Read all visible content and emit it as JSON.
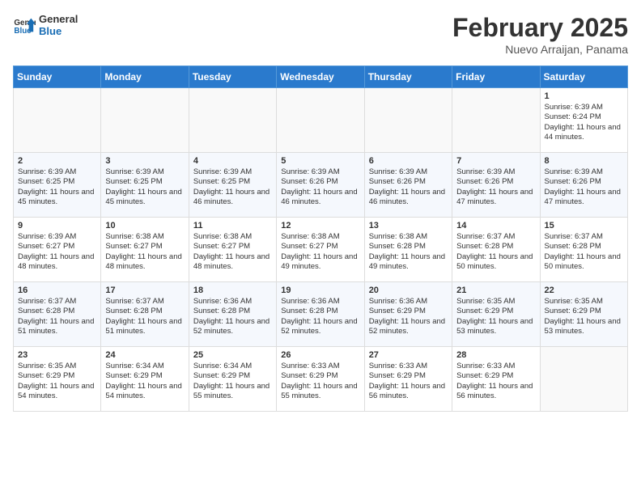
{
  "logo": {
    "line1": "General",
    "line2": "Blue"
  },
  "title": "February 2025",
  "subtitle": "Nuevo Arraijan, Panama",
  "days_header": [
    "Sunday",
    "Monday",
    "Tuesday",
    "Wednesday",
    "Thursday",
    "Friday",
    "Saturday"
  ],
  "weeks": [
    [
      {
        "day": "",
        "info": ""
      },
      {
        "day": "",
        "info": ""
      },
      {
        "day": "",
        "info": ""
      },
      {
        "day": "",
        "info": ""
      },
      {
        "day": "",
        "info": ""
      },
      {
        "day": "",
        "info": ""
      },
      {
        "day": "1",
        "info": "Sunrise: 6:39 AM\nSunset: 6:24 PM\nDaylight: 11 hours and 44 minutes."
      }
    ],
    [
      {
        "day": "2",
        "info": "Sunrise: 6:39 AM\nSunset: 6:25 PM\nDaylight: 11 hours and 45 minutes."
      },
      {
        "day": "3",
        "info": "Sunrise: 6:39 AM\nSunset: 6:25 PM\nDaylight: 11 hours and 45 minutes."
      },
      {
        "day": "4",
        "info": "Sunrise: 6:39 AM\nSunset: 6:25 PM\nDaylight: 11 hours and 46 minutes."
      },
      {
        "day": "5",
        "info": "Sunrise: 6:39 AM\nSunset: 6:26 PM\nDaylight: 11 hours and 46 minutes."
      },
      {
        "day": "6",
        "info": "Sunrise: 6:39 AM\nSunset: 6:26 PM\nDaylight: 11 hours and 46 minutes."
      },
      {
        "day": "7",
        "info": "Sunrise: 6:39 AM\nSunset: 6:26 PM\nDaylight: 11 hours and 47 minutes."
      },
      {
        "day": "8",
        "info": "Sunrise: 6:39 AM\nSunset: 6:26 PM\nDaylight: 11 hours and 47 minutes."
      }
    ],
    [
      {
        "day": "9",
        "info": "Sunrise: 6:39 AM\nSunset: 6:27 PM\nDaylight: 11 hours and 48 minutes."
      },
      {
        "day": "10",
        "info": "Sunrise: 6:38 AM\nSunset: 6:27 PM\nDaylight: 11 hours and 48 minutes."
      },
      {
        "day": "11",
        "info": "Sunrise: 6:38 AM\nSunset: 6:27 PM\nDaylight: 11 hours and 48 minutes."
      },
      {
        "day": "12",
        "info": "Sunrise: 6:38 AM\nSunset: 6:27 PM\nDaylight: 11 hours and 49 minutes."
      },
      {
        "day": "13",
        "info": "Sunrise: 6:38 AM\nSunset: 6:28 PM\nDaylight: 11 hours and 49 minutes."
      },
      {
        "day": "14",
        "info": "Sunrise: 6:37 AM\nSunset: 6:28 PM\nDaylight: 11 hours and 50 minutes."
      },
      {
        "day": "15",
        "info": "Sunrise: 6:37 AM\nSunset: 6:28 PM\nDaylight: 11 hours and 50 minutes."
      }
    ],
    [
      {
        "day": "16",
        "info": "Sunrise: 6:37 AM\nSunset: 6:28 PM\nDaylight: 11 hours and 51 minutes."
      },
      {
        "day": "17",
        "info": "Sunrise: 6:37 AM\nSunset: 6:28 PM\nDaylight: 11 hours and 51 minutes."
      },
      {
        "day": "18",
        "info": "Sunrise: 6:36 AM\nSunset: 6:28 PM\nDaylight: 11 hours and 52 minutes."
      },
      {
        "day": "19",
        "info": "Sunrise: 6:36 AM\nSunset: 6:28 PM\nDaylight: 11 hours and 52 minutes."
      },
      {
        "day": "20",
        "info": "Sunrise: 6:36 AM\nSunset: 6:29 PM\nDaylight: 11 hours and 52 minutes."
      },
      {
        "day": "21",
        "info": "Sunrise: 6:35 AM\nSunset: 6:29 PM\nDaylight: 11 hours and 53 minutes."
      },
      {
        "day": "22",
        "info": "Sunrise: 6:35 AM\nSunset: 6:29 PM\nDaylight: 11 hours and 53 minutes."
      }
    ],
    [
      {
        "day": "23",
        "info": "Sunrise: 6:35 AM\nSunset: 6:29 PM\nDaylight: 11 hours and 54 minutes."
      },
      {
        "day": "24",
        "info": "Sunrise: 6:34 AM\nSunset: 6:29 PM\nDaylight: 11 hours and 54 minutes."
      },
      {
        "day": "25",
        "info": "Sunrise: 6:34 AM\nSunset: 6:29 PM\nDaylight: 11 hours and 55 minutes."
      },
      {
        "day": "26",
        "info": "Sunrise: 6:33 AM\nSunset: 6:29 PM\nDaylight: 11 hours and 55 minutes."
      },
      {
        "day": "27",
        "info": "Sunrise: 6:33 AM\nSunset: 6:29 PM\nDaylight: 11 hours and 56 minutes."
      },
      {
        "day": "28",
        "info": "Sunrise: 6:33 AM\nSunset: 6:29 PM\nDaylight: 11 hours and 56 minutes."
      },
      {
        "day": "",
        "info": ""
      }
    ]
  ]
}
